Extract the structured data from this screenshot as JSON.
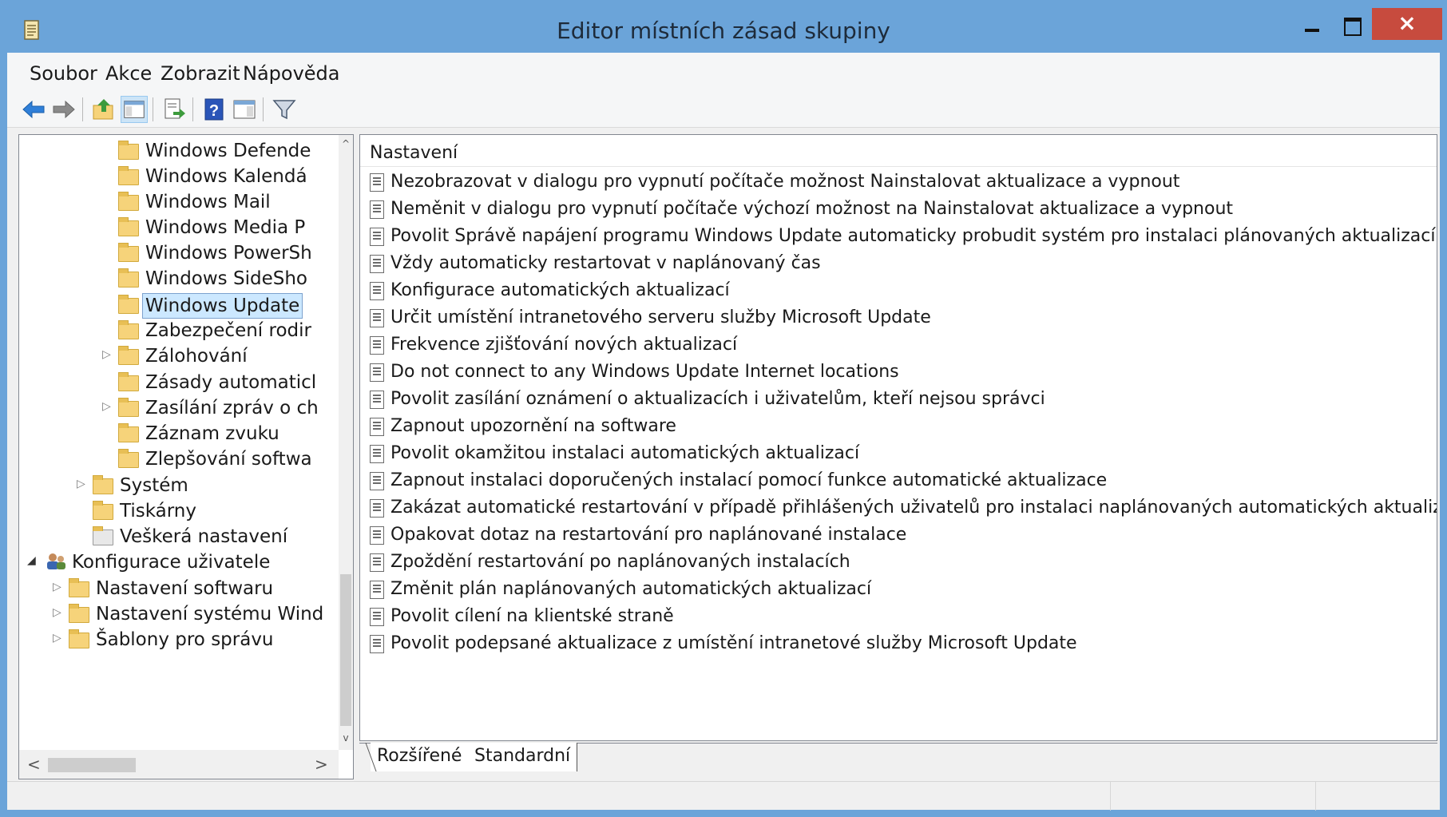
{
  "window": {
    "title": "Editor místních zásad skupiny",
    "close_glyph": "×"
  },
  "menu": [
    "Soubor",
    "Akce",
    "Zobrazit",
    "Nápověda"
  ],
  "toolbar": {
    "icons": [
      "back-icon",
      "forward-icon",
      "up-folder-icon",
      "show-hide-tree-icon",
      "export-list-icon",
      "help-icon",
      "properties-icon",
      "filter-icon"
    ]
  },
  "tree": {
    "items": [
      {
        "label": "Windows Defende",
        "expander": ""
      },
      {
        "label": "Windows Kalendá",
        "expander": ""
      },
      {
        "label": "Windows Mail",
        "expander": ""
      },
      {
        "label": "Windows Media P",
        "expander": ""
      },
      {
        "label": "Windows PowerSh",
        "expander": ""
      },
      {
        "label": "Windows SideSho",
        "expander": ""
      },
      {
        "label": "Windows Update",
        "expander": "",
        "selected": true
      },
      {
        "label": "Zabezpečení rodir",
        "expander": ""
      },
      {
        "label": "Zálohování",
        "expander": "▷"
      },
      {
        "label": "Zásady automaticl",
        "expander": ""
      },
      {
        "label": "Zasílání zpráv o ch",
        "expander": "▷"
      },
      {
        "label": "Záznam zvuku",
        "expander": ""
      },
      {
        "label": "Zlepšování softwa",
        "expander": ""
      },
      {
        "label": "Systém",
        "expander": "▷"
      },
      {
        "label": "Tiskárny",
        "expander": ""
      },
      {
        "label": "Veškerá nastavení",
        "expander": ""
      },
      {
        "label": "Konfigurace uživatele",
        "expander": "◢"
      },
      {
        "label": "Nastavení softwaru",
        "expander": "▷"
      },
      {
        "label": "Nastavení systému Wind",
        "expander": "▷"
      },
      {
        "label": "Šablony pro správu",
        "expander": "▷"
      }
    ],
    "scroll_up": "^",
    "scroll_down": "v",
    "scroll_left": "<",
    "scroll_right": ">"
  },
  "settings": {
    "column_header": "Nastavení",
    "rows": [
      "Nezobrazovat v dialogu pro vypnutí počítače možnost Nainstalovat aktualizace a vypnout",
      "Neměnit v dialogu pro vypnutí počítače výchozí možnost na Nainstalovat aktualizace a vypnout",
      "Povolit Správě napájení programu Windows Update automaticky probudit systém pro instalaci plánovaných aktualizací",
      "Vždy automaticky restartovat v naplánovaný čas",
      "Konfigurace automatických aktualizací",
      "Určit umístění intranetového serveru služby Microsoft Update",
      "Frekvence zjišťování nových aktualizací",
      "Do not connect to any Windows Update Internet locations",
      "Povolit zasílání oznámení o aktualizacích i uživatelům, kteří nejsou správci",
      "Zapnout upozornění na software",
      "Povolit okamžitou instalaci automatických aktualizací",
      "Zapnout instalaci doporučených instalací pomocí funkce automatické aktualizace",
      "Zakázat automatické restartování v případě přihlášených uživatelů pro instalaci naplánovaných automatických aktualizací",
      "Opakovat dotaz na restartování pro naplánované instalace",
      "Zpoždění restartování po naplánovaných instalacích",
      "Změnit plán naplánovaných automatických aktualizací",
      "Povolit cílení na klientské straně",
      "Povolit podepsané aktualizace z umístění intranetové služby Microsoft Update"
    ]
  },
  "tabs": [
    "Rozšířené",
    "Standardní"
  ],
  "colors": {
    "titlebar": "#6ba4d9",
    "close": "#c74b3e",
    "selection": "#cce8ff",
    "folder": "#f6d37a"
  }
}
